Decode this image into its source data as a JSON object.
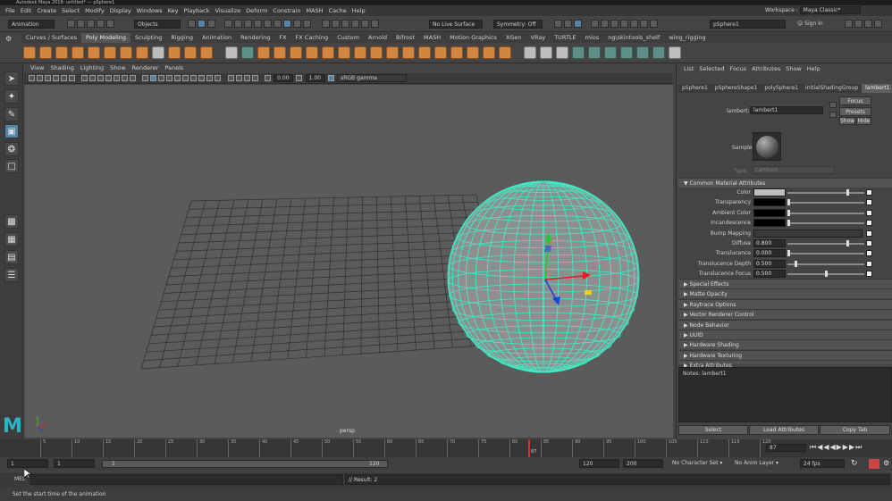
{
  "window": {
    "title": "Autodesk Maya 2018: untitled* --- pSphere1"
  },
  "menu": [
    "File",
    "Edit",
    "Create",
    "Select",
    "Modify",
    "Display",
    "Windows",
    "Key",
    "Playback",
    "Visualize",
    "Deform",
    "Constrain",
    "MASH",
    "Cache",
    "Help"
  ],
  "workspace": {
    "label": "Workspace :",
    "value": "Maya Classic*"
  },
  "status": {
    "menuset": "Animation",
    "objects": "Objects",
    "live": "No Live Surface",
    "symmetry": "Symmetry: Off",
    "object_name": "pSphere1",
    "sign_in": "Sign In"
  },
  "shelf_tabs": [
    "Curves / Surfaces",
    "Poly Modeling",
    "Sculpting",
    "Rigging",
    "Animation",
    "Rendering",
    "FX",
    "FX Caching",
    "Custom",
    "Arnold",
    "Bifrost",
    "MASH",
    "Motion Graphics",
    "XGen",
    "VRay",
    "TURTLE",
    "mios",
    "ng\\skintools_shelf",
    "wing_rigging"
  ],
  "panel_menu": [
    "View",
    "Shading",
    "Lighting",
    "Show",
    "Renderer",
    "Panels"
  ],
  "panel_toolbar": {
    "exposure": "0.00",
    "gamma": "1.00",
    "colorspace": "sRGB gamma"
  },
  "viewport": {
    "camera": "persp"
  },
  "attr_editor": {
    "menu": [
      "List",
      "Selected",
      "Focus",
      "Attributes",
      "Show",
      "Help"
    ],
    "tabs": [
      "pSphere1",
      "pSphereShape1",
      "polySphere1",
      "initialShadingGroup",
      "lambert1"
    ],
    "type_label": "lambert:",
    "name": "lambert1",
    "focus": "Focus",
    "presets": "Presets",
    "show": "Show",
    "hide": "Hide",
    "sample": "Sample",
    "type_row": "Type",
    "type_value": "Lambert",
    "common_section": "Common Material Attributes",
    "attrs": [
      {
        "label": "Color",
        "value": ""
      },
      {
        "label": "Transparency",
        "value": ""
      },
      {
        "label": "Ambient Color",
        "value": ""
      },
      {
        "label": "Incandescence",
        "value": ""
      },
      {
        "label": "Bump Mapping",
        "value": ""
      },
      {
        "label": "Diffuse",
        "value": "0.800"
      },
      {
        "label": "Translucence",
        "value": "0.000"
      },
      {
        "label": "Translucence Depth",
        "value": "0.500"
      },
      {
        "label": "Translucence Focus",
        "value": "0.500"
      }
    ],
    "sections": [
      "Special Effects",
      "Matte Opacity",
      "Raytrace Options",
      "Vector Renderer Control",
      "Node Behavior",
      "UUID",
      "Hardware Shading",
      "Hardware Texturing",
      "Extra Attributes"
    ],
    "notes": "Notes:  lambert1",
    "buttons": {
      "select": "Select",
      "load": "Load Attributes",
      "copy": "Copy Tab"
    }
  },
  "timeline": {
    "ticks": [
      "5",
      "10",
      "15",
      "20",
      "25",
      "30",
      "35",
      "40",
      "45",
      "50",
      "55",
      "60",
      "65",
      "70",
      "75",
      "80",
      "85",
      "90",
      "95",
      "100",
      "105",
      "110",
      "115",
      "120"
    ],
    "current": "87",
    "current_field": "87"
  },
  "range": {
    "start": "1",
    "start2": "1",
    "slider_start": "1",
    "slider_end": "120",
    "end": "120",
    "end2": "200",
    "char_set": "No Character Set",
    "anim_layer": "No Anim Layer",
    "fps": "24 fps"
  },
  "cmd": {
    "lang": "MEL",
    "result": "// Result: 2"
  },
  "help": "Set the start time of the animation",
  "colors": {
    "wire": "#40e8c2",
    "accent": "#5285a6",
    "timemark": "#cc3333"
  }
}
